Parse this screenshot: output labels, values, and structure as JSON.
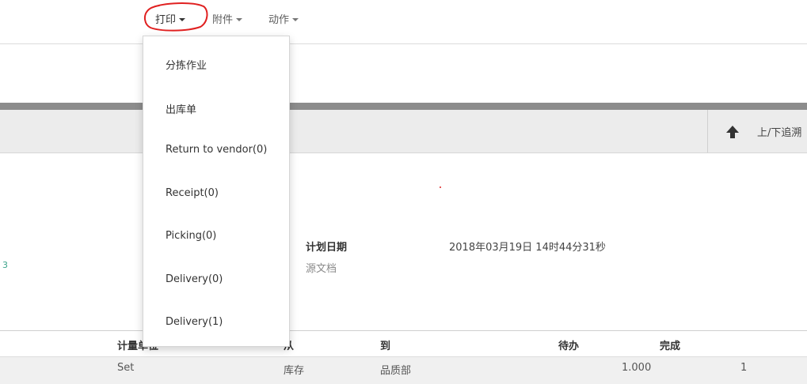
{
  "toolbar": {
    "print_label": "打印",
    "attachment_label": "附件",
    "action_label": "动作"
  },
  "trace": {
    "label": "上/下追溯"
  },
  "print_menu": {
    "items": [
      "分拣作业",
      "出库单",
      "Return to vendor(0)",
      "Receipt(0)",
      "Picking(0)",
      "Delivery(0)",
      "Delivery(1)"
    ]
  },
  "form": {
    "scheduled_date_label": "计划日期",
    "scheduled_date_value": "2018年03月19日 14时44分31秒",
    "source_doc_label": "源文档",
    "left_fragment": "3"
  },
  "table": {
    "headers": {
      "uom": "计量单位",
      "from": "从",
      "to": "到",
      "todo": "待办",
      "done": "完成"
    },
    "rows": [
      {
        "uom": "Set",
        "from": "库存",
        "to": "品质部",
        "todo": "1.000",
        "done": "1"
      }
    ]
  },
  "colors": {
    "annotation": "#e02020",
    "bar_dark": "#8c8c8c",
    "bar_light": "#ececec"
  }
}
